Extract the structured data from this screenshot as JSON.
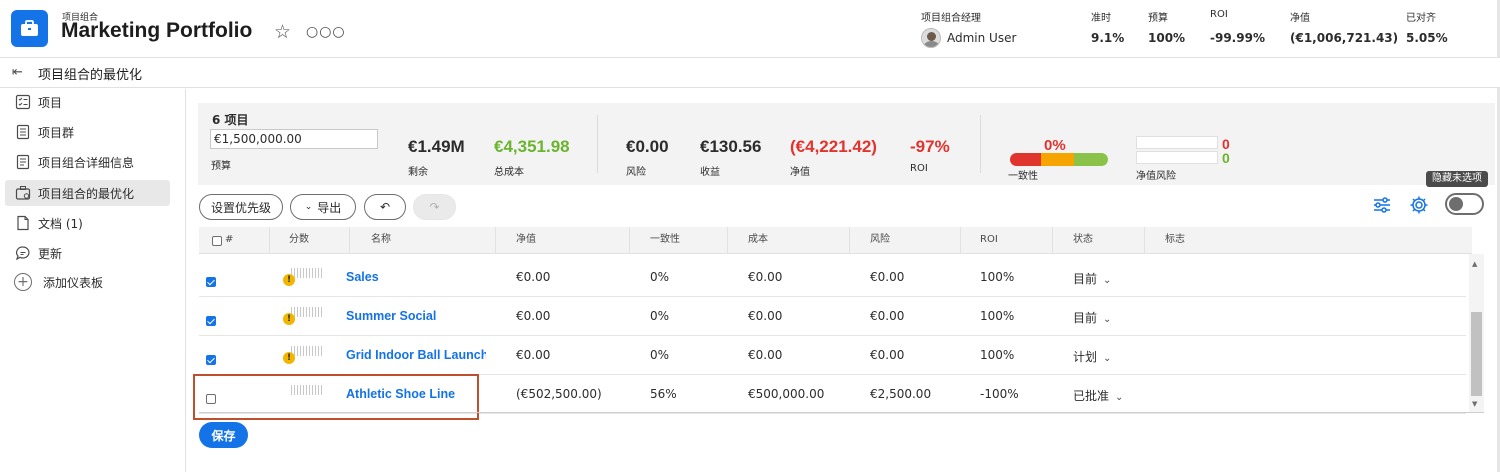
{
  "header": {
    "kicker": "项目组合",
    "title": "Marketing Portfolio",
    "stats": {
      "manager_label": "项目组合经理",
      "manager_value": "Admin User",
      "on_time_label": "准时",
      "on_time_value": "9.1%",
      "budget_label": "预算",
      "budget_value": "100%",
      "roi_label": "ROI",
      "roi_value": "-99.99%",
      "net_value_label": "净值",
      "net_value_value": "(€1,006,721.43)",
      "aligned_label": "已对齐",
      "aligned_value": "5.05%"
    }
  },
  "subheader": {
    "title": "项目组合的最优化"
  },
  "sidebar": {
    "items": [
      {
        "label": "项目",
        "icon": "project-list-icon"
      },
      {
        "label": "项目群",
        "icon": "program-icon"
      },
      {
        "label": "项目组合详细信息",
        "icon": "details-icon"
      },
      {
        "label": "项目组合的最优化",
        "icon": "optimizer-icon",
        "active": true
      },
      {
        "label": "文档 (1)",
        "icon": "document-icon"
      },
      {
        "label": "更新",
        "icon": "chat-icon"
      },
      {
        "label": "添加仪表板",
        "icon": "plus-circle-icon"
      }
    ]
  },
  "summary": {
    "count": "6 项目",
    "budget_input": "€1,500,000.00",
    "budget_label": "预算",
    "remaining_value": "€1.49M",
    "remaining_label": "剩余",
    "total_cost_value": "€4,351.98",
    "total_cost_label": "总成本",
    "risk_value": "€0.00",
    "risk_label": "风险",
    "income_value": "€130.56",
    "income_label": "收益",
    "net_value": "(€4,221.42)",
    "net_label": "净值",
    "roi_value": "-97%",
    "roi_label": "ROI",
    "alignment_value": "0%",
    "alignment_label": "一致性",
    "alignment_colors": [
      "#e0342e",
      "#f5a400",
      "#8bc34a"
    ],
    "net_risk_top": "0",
    "net_risk_bottom": "0",
    "net_risk_label": "净值风险"
  },
  "toolbar": {
    "prioritize_label": "设置优先级",
    "export_label": "导出",
    "tooltip": "隐藏未选项"
  },
  "table": {
    "headers": [
      "#",
      "分数",
      "名称",
      "净值",
      "一致性",
      "成本",
      "风险",
      "ROI",
      "状态",
      "标志"
    ],
    "rows": [
      {
        "checked": true,
        "warn": true,
        "name": "Sales",
        "net_value": "€0.00",
        "alignment": "0%",
        "cost": "€0.00",
        "risk": "€0.00",
        "roi": "100%",
        "status": "目前"
      },
      {
        "checked": true,
        "warn": true,
        "name": "Summer Social",
        "net_value": "€0.00",
        "alignment": "0%",
        "cost": "€0.00",
        "risk": "€0.00",
        "roi": "100%",
        "status": "目前"
      },
      {
        "checked": true,
        "warn": true,
        "name": "Grid Indoor Ball Launch",
        "net_value": "€0.00",
        "alignment": "0%",
        "cost": "€0.00",
        "risk": "€0.00",
        "roi": "100%",
        "status": "计划"
      },
      {
        "checked": false,
        "warn": false,
        "name": "Athletic Shoe Line",
        "net_value": "(€502,500.00)",
        "alignment": "56%",
        "cost": "€500,000.00",
        "risk": "€2,500.00",
        "roi": "-100%",
        "status": "已批准"
      }
    ]
  },
  "save_label": "保存"
}
